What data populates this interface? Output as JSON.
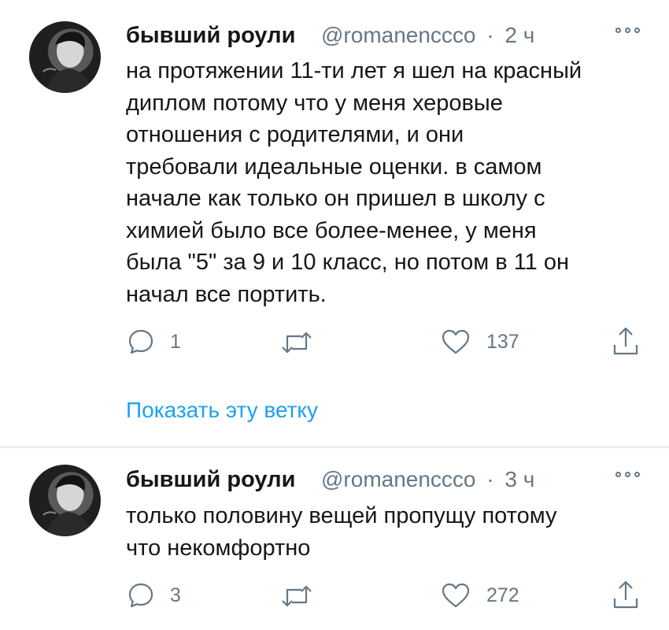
{
  "tweets": [
    {
      "author_name": "бывший роули",
      "handle": "@romanenccco",
      "separator": "·",
      "time": "2 ч",
      "text": "на протяжении 11-ти лет я шел на красный\nдиплом потому что у меня херовые\nотношения с родителями, и они\nтребовали идеальные оценки. в самом\nначале как только он пришел в школу с\nхимией было все более-менее, у меня\nбыла \"5\" за 9 и 10 класс, но потом в 11 он\nначал все портить.",
      "reply_count": "1",
      "retweet_count": "",
      "like_count": "137",
      "thread_link": "Показать эту ветку"
    },
    {
      "author_name": "бывший роули",
      "handle": "@romanenccco",
      "separator": "·",
      "time": "3 ч",
      "text": "только половину вещей пропущу потому\nчто некомфортно",
      "reply_count": "3",
      "retweet_count": "",
      "like_count": "272"
    }
  ],
  "colors": {
    "text": "#14171a",
    "secondary": "#657786",
    "link": "#1da1f2",
    "divider": "#e6ecf0"
  },
  "icons": [
    "reply-icon",
    "retweet-icon",
    "like-icon",
    "share-icon",
    "more-icon"
  ]
}
